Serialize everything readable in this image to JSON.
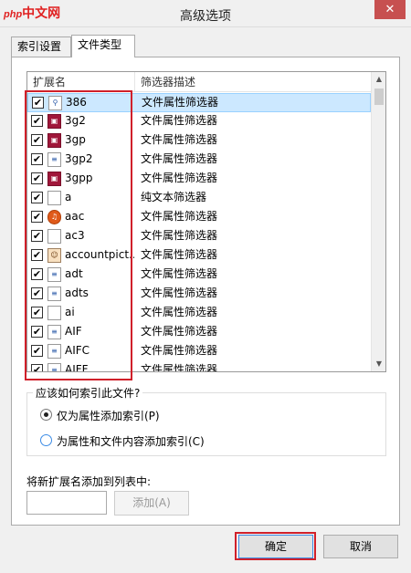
{
  "window": {
    "logo_main": "中文网",
    "logo_php": "php",
    "title": "高级选项",
    "close_glyph": "✕"
  },
  "tabs": [
    {
      "label": "索引设置",
      "active": false
    },
    {
      "label": "文件类型",
      "active": true
    }
  ],
  "file_list": {
    "columns": [
      "扩展名",
      "筛选器描述"
    ],
    "rows": [
      {
        "ext": "386",
        "desc": "文件属性筛选器",
        "checked": true,
        "icon": "link-file-icon",
        "selected": true
      },
      {
        "ext": "3g2",
        "desc": "文件属性筛选器",
        "checked": true,
        "icon": "media-file-icon",
        "selected": false
      },
      {
        "ext": "3gp",
        "desc": "文件属性筛选器",
        "checked": true,
        "icon": "media-file-icon",
        "selected": false
      },
      {
        "ext": "3gp2",
        "desc": "文件属性筛选器",
        "checked": true,
        "icon": "generic-file-icon",
        "selected": false
      },
      {
        "ext": "3gpp",
        "desc": "文件属性筛选器",
        "checked": true,
        "icon": "media-file-icon",
        "selected": false
      },
      {
        "ext": "a",
        "desc": "纯文本筛选器",
        "checked": true,
        "icon": "blank-file-icon",
        "selected": false
      },
      {
        "ext": "aac",
        "desc": "文件属性筛选器",
        "checked": true,
        "icon": "audio-file-icon",
        "selected": false
      },
      {
        "ext": "ac3",
        "desc": "文件属性筛选器",
        "checked": true,
        "icon": "blank-file-icon",
        "selected": false
      },
      {
        "ext": "accountpict...",
        "desc": "文件属性筛选器",
        "checked": true,
        "icon": "user-file-icon",
        "selected": false
      },
      {
        "ext": "adt",
        "desc": "文件属性筛选器",
        "checked": true,
        "icon": "generic-file-icon",
        "selected": false
      },
      {
        "ext": "adts",
        "desc": "文件属性筛选器",
        "checked": true,
        "icon": "generic-file-icon",
        "selected": false
      },
      {
        "ext": "ai",
        "desc": "文件属性筛选器",
        "checked": true,
        "icon": "blank-file-icon",
        "selected": false
      },
      {
        "ext": "AIF",
        "desc": "文件属性筛选器",
        "checked": true,
        "icon": "generic-file-icon",
        "selected": false
      },
      {
        "ext": "AIFC",
        "desc": "文件属性筛选器",
        "checked": true,
        "icon": "generic-file-icon",
        "selected": false
      },
      {
        "ext": "AIFF",
        "desc": "文件属性筛选器",
        "checked": true,
        "icon": "generic-file-icon",
        "selected": false
      }
    ]
  },
  "index_group": {
    "legend": "应该如何索引此文件?",
    "options": [
      {
        "label": "仅为属性添加索引(P)",
        "selected": true
      },
      {
        "label": "为属性和文件内容添加索引(C)",
        "selected": false
      }
    ]
  },
  "add_extension": {
    "label": "将新扩展名添加到列表中:",
    "value": "",
    "button_label": "添加(A)"
  },
  "dialog_buttons": {
    "ok_label": "确定",
    "cancel_label": "取消"
  },
  "colors": {
    "highlight_red": "#d0202a",
    "selection_blue": "#cce8ff",
    "close_red": "#c75050"
  }
}
